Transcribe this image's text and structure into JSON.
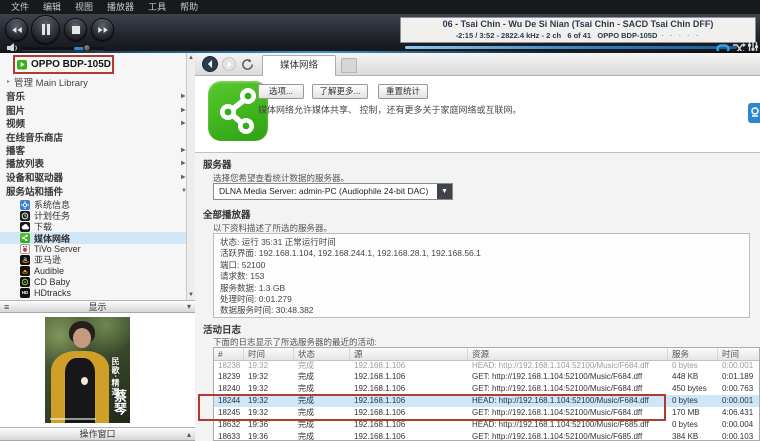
{
  "menu_bar": {
    "items": [
      "文件",
      "编辑",
      "视图",
      "播放器",
      "工具",
      "帮助"
    ]
  },
  "player": {
    "now_playing_line1": "06 - Tsai Chin - Wu De Si Nian (Tsai Chin - SACD Tsai Chin DFF)",
    "now_playing_line2": "-2:15 / 3:52 - 2822.4 kHz - 2 ch   6 of 41   OPPO BDP-105D",
    "rating_dots": "· · · · ·"
  },
  "sidebar": {
    "device_label": "OPPO BDP-105D",
    "library_label": "管理 Main Library",
    "items": [
      {
        "label": "音乐"
      },
      {
        "label": "图片"
      },
      {
        "label": "视频"
      },
      {
        "label": "在线音乐商店"
      },
      {
        "label": "播客"
      },
      {
        "label": "播放列表"
      },
      {
        "label": "设备和驱动器"
      },
      {
        "label": "服务站和插件"
      }
    ],
    "services": [
      {
        "label": "系统信息"
      },
      {
        "label": "计划任务"
      },
      {
        "label": "下载"
      },
      {
        "label": "媒体网络"
      },
      {
        "label": "TiVo Server"
      },
      {
        "label": "亚马逊"
      },
      {
        "label": "Audible"
      },
      {
        "label": "CD Baby"
      },
      {
        "label": "HDtracks"
      }
    ],
    "display_bar_label": "显示",
    "action_bar_label": "操作窗口",
    "album_art": {
      "title": "民歌·精選",
      "artist": "蔡琴"
    }
  },
  "main": {
    "tab_label": "媒体网络",
    "buttons": {
      "options": "选项...",
      "learn_more": "了解更多...",
      "reset_stats": "重置统计"
    },
    "description": "媒体网络允许媒体共享、 控制，还有更多关于家庭网络或互联网。",
    "server_section": {
      "title": "服务器",
      "hint": "选择您希望查看统计数据的服务器。",
      "dropdown_value": "DLNA Media Server: admin-PC (Audiophile 24-bit DAC)"
    },
    "players_section": {
      "title": "全部播放器",
      "hint": "以下资料描述了所选的服务器。",
      "status_lines": [
        "状态: 运行 35:31 正常运行时间",
        "活跃界面: 192.168.1.104, 192.168.244.1, 192.168.28.1, 192.168.56.1",
        "端口: 52100",
        "请求数: 153",
        "服务数据: 1.3 GB",
        "处理时间: 0:01.279",
        "数据服务时间: 30:48.382"
      ]
    },
    "activity_section": {
      "title": "活动日志",
      "hint": "下面的日志显示了所选服务器的最近的活动:",
      "table": {
        "headers": [
          "#",
          "时间",
          "状态",
          "源",
          "资源",
          "服务",
          "时间"
        ],
        "rows": [
          [
            "18238",
            "19:32",
            "完成",
            "192.168.1.106",
            "HEAD: http://192.168.1.104:52100/Music/F684.dff",
            "0 bytes",
            "0:00.001"
          ],
          [
            "18239",
            "19:32",
            "完成",
            "192.168.1.106",
            "GET: http://192.168.1.104:52100/Music/F684.dff",
            "448 KB",
            "0:01.189"
          ],
          [
            "18240",
            "19:32",
            "完成",
            "192.168.1.106",
            "GET: http://192.168.1.104:52100/Music/F684.dff",
            "450 bytes",
            "0:00.763"
          ],
          [
            "18244",
            "19:32",
            "完成",
            "192.168.1.106",
            "HEAD: http://192.168.1.104:52100/Music/F684.dff",
            "0 bytes",
            "0:00.001"
          ],
          [
            "18245",
            "19:32",
            "完成",
            "192.168.1.106",
            "GET: http://192.168.1.104:52100/Music/F684.dff",
            "170 MB",
            "4:06.431"
          ],
          [
            "18632",
            "19:36",
            "完成",
            "192.168.1.106",
            "HEAD: http://192.168.1.104:52100/Music/F685.dff",
            "0 bytes",
            "0:00.004"
          ],
          [
            "18633",
            "19:36",
            "完成",
            "192.168.1.106",
            "GET: http://192.168.1.104:52100/Music/F685.dff",
            "384 KB",
            "0:00.103"
          ]
        ]
      }
    }
  },
  "icons": {
    "expand_right": "▶",
    "expand_down": "▼",
    "expander_small": "▸",
    "scroll_up": "▲",
    "scroll_down": "▼",
    "collapse_down": "▾",
    "collapse_up": "▴",
    "list_menu": "≡",
    "dropdown_arrow": "▼",
    "hd_label": "HD",
    "amazon_letter": "a"
  },
  "colors": {
    "accent_blue": "#2e7fc1",
    "selection_blue": "#cfe7f8",
    "annotation_red": "#b23a31",
    "brand_green": "#35b31c"
  }
}
